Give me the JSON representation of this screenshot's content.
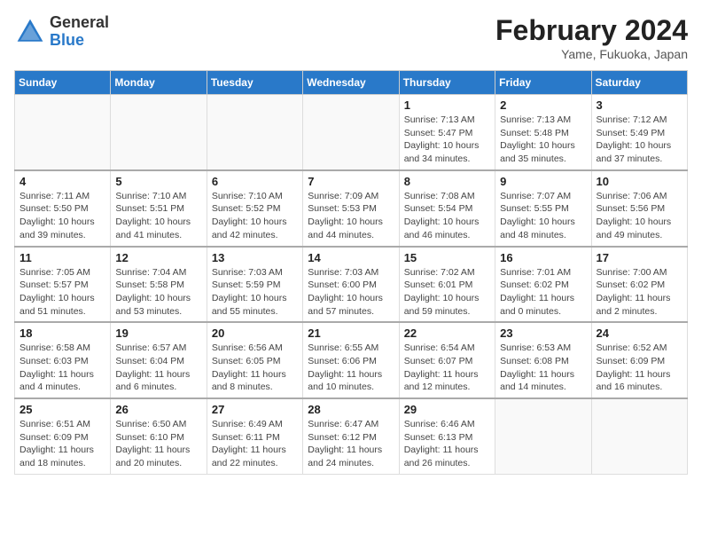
{
  "header": {
    "logo": {
      "general": "General",
      "blue": "Blue"
    },
    "title": "February 2024",
    "subtitle": "Yame, Fukuoka, Japan"
  },
  "days_of_week": [
    "Sunday",
    "Monday",
    "Tuesday",
    "Wednesday",
    "Thursday",
    "Friday",
    "Saturday"
  ],
  "weeks": [
    [
      {
        "day": "",
        "detail": ""
      },
      {
        "day": "",
        "detail": ""
      },
      {
        "day": "",
        "detail": ""
      },
      {
        "day": "",
        "detail": ""
      },
      {
        "day": "1",
        "detail": "Sunrise: 7:13 AM\nSunset: 5:47 PM\nDaylight: 10 hours\nand 34 minutes."
      },
      {
        "day": "2",
        "detail": "Sunrise: 7:13 AM\nSunset: 5:48 PM\nDaylight: 10 hours\nand 35 minutes."
      },
      {
        "day": "3",
        "detail": "Sunrise: 7:12 AM\nSunset: 5:49 PM\nDaylight: 10 hours\nand 37 minutes."
      }
    ],
    [
      {
        "day": "4",
        "detail": "Sunrise: 7:11 AM\nSunset: 5:50 PM\nDaylight: 10 hours\nand 39 minutes."
      },
      {
        "day": "5",
        "detail": "Sunrise: 7:10 AM\nSunset: 5:51 PM\nDaylight: 10 hours\nand 41 minutes."
      },
      {
        "day": "6",
        "detail": "Sunrise: 7:10 AM\nSunset: 5:52 PM\nDaylight: 10 hours\nand 42 minutes."
      },
      {
        "day": "7",
        "detail": "Sunrise: 7:09 AM\nSunset: 5:53 PM\nDaylight: 10 hours\nand 44 minutes."
      },
      {
        "day": "8",
        "detail": "Sunrise: 7:08 AM\nSunset: 5:54 PM\nDaylight: 10 hours\nand 46 minutes."
      },
      {
        "day": "9",
        "detail": "Sunrise: 7:07 AM\nSunset: 5:55 PM\nDaylight: 10 hours\nand 48 minutes."
      },
      {
        "day": "10",
        "detail": "Sunrise: 7:06 AM\nSunset: 5:56 PM\nDaylight: 10 hours\nand 49 minutes."
      }
    ],
    [
      {
        "day": "11",
        "detail": "Sunrise: 7:05 AM\nSunset: 5:57 PM\nDaylight: 10 hours\nand 51 minutes."
      },
      {
        "day": "12",
        "detail": "Sunrise: 7:04 AM\nSunset: 5:58 PM\nDaylight: 10 hours\nand 53 minutes."
      },
      {
        "day": "13",
        "detail": "Sunrise: 7:03 AM\nSunset: 5:59 PM\nDaylight: 10 hours\nand 55 minutes."
      },
      {
        "day": "14",
        "detail": "Sunrise: 7:03 AM\nSunset: 6:00 PM\nDaylight: 10 hours\nand 57 minutes."
      },
      {
        "day": "15",
        "detail": "Sunrise: 7:02 AM\nSunset: 6:01 PM\nDaylight: 10 hours\nand 59 minutes."
      },
      {
        "day": "16",
        "detail": "Sunrise: 7:01 AM\nSunset: 6:02 PM\nDaylight: 11 hours\nand 0 minutes."
      },
      {
        "day": "17",
        "detail": "Sunrise: 7:00 AM\nSunset: 6:02 PM\nDaylight: 11 hours\nand 2 minutes."
      }
    ],
    [
      {
        "day": "18",
        "detail": "Sunrise: 6:58 AM\nSunset: 6:03 PM\nDaylight: 11 hours\nand 4 minutes."
      },
      {
        "day": "19",
        "detail": "Sunrise: 6:57 AM\nSunset: 6:04 PM\nDaylight: 11 hours\nand 6 minutes."
      },
      {
        "day": "20",
        "detail": "Sunrise: 6:56 AM\nSunset: 6:05 PM\nDaylight: 11 hours\nand 8 minutes."
      },
      {
        "day": "21",
        "detail": "Sunrise: 6:55 AM\nSunset: 6:06 PM\nDaylight: 11 hours\nand 10 minutes."
      },
      {
        "day": "22",
        "detail": "Sunrise: 6:54 AM\nSunset: 6:07 PM\nDaylight: 11 hours\nand 12 minutes."
      },
      {
        "day": "23",
        "detail": "Sunrise: 6:53 AM\nSunset: 6:08 PM\nDaylight: 11 hours\nand 14 minutes."
      },
      {
        "day": "24",
        "detail": "Sunrise: 6:52 AM\nSunset: 6:09 PM\nDaylight: 11 hours\nand 16 minutes."
      }
    ],
    [
      {
        "day": "25",
        "detail": "Sunrise: 6:51 AM\nSunset: 6:09 PM\nDaylight: 11 hours\nand 18 minutes."
      },
      {
        "day": "26",
        "detail": "Sunrise: 6:50 AM\nSunset: 6:10 PM\nDaylight: 11 hours\nand 20 minutes."
      },
      {
        "day": "27",
        "detail": "Sunrise: 6:49 AM\nSunset: 6:11 PM\nDaylight: 11 hours\nand 22 minutes."
      },
      {
        "day": "28",
        "detail": "Sunrise: 6:47 AM\nSunset: 6:12 PM\nDaylight: 11 hours\nand 24 minutes."
      },
      {
        "day": "29",
        "detail": "Sunrise: 6:46 AM\nSunset: 6:13 PM\nDaylight: 11 hours\nand 26 minutes."
      },
      {
        "day": "",
        "detail": ""
      },
      {
        "day": "",
        "detail": ""
      }
    ]
  ]
}
